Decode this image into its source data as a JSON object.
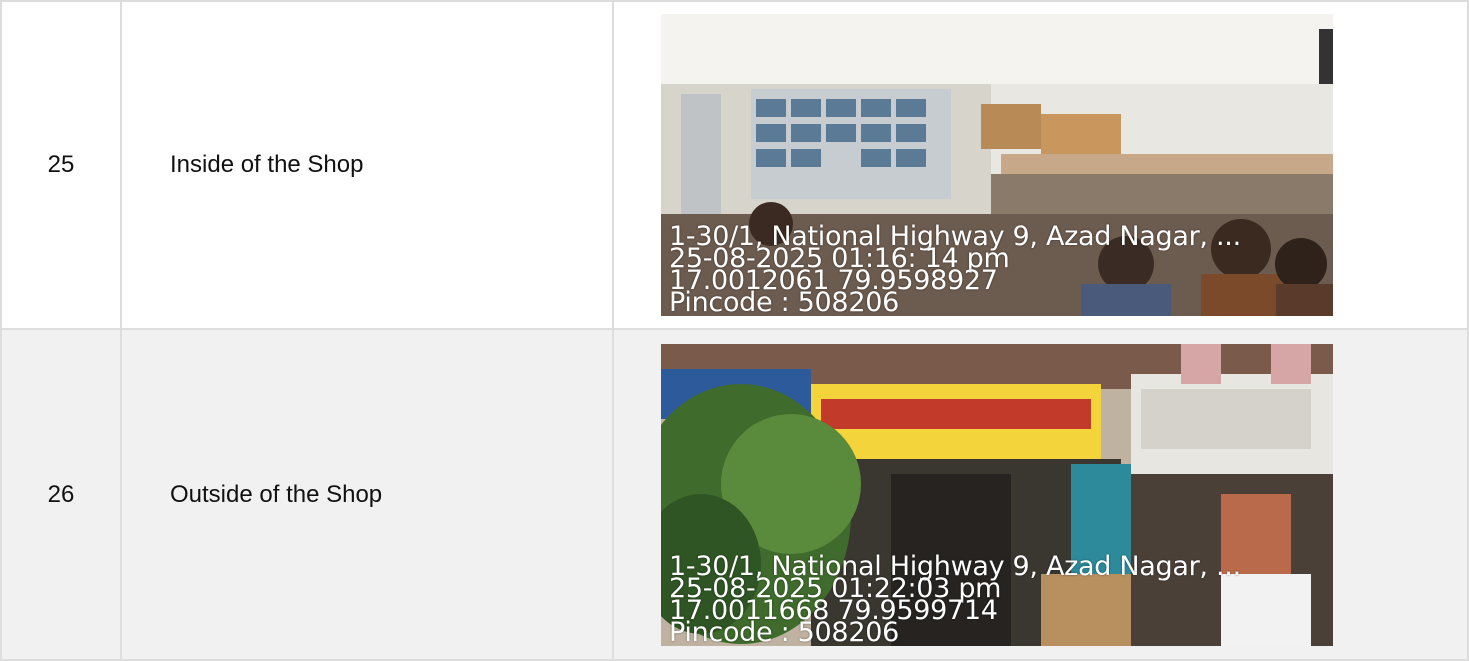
{
  "rows": [
    {
      "number": "25",
      "description": "Inside of the Shop",
      "photo": {
        "icon": "shop-interior-photo",
        "stamp": {
          "address": "1-30/1, National Highway 9, Azad Nagar, ...",
          "datetime": "25-08-2025 01:16: 14 pm",
          "coords": "17.0012061 79.9598927",
          "pincode": "Pincode : 508206"
        }
      }
    },
    {
      "number": "26",
      "description": "Outside of the Shop",
      "photo": {
        "icon": "shop-exterior-photo",
        "stamp": {
          "address": "1-30/1, National Highway 9, Azad Nagar, ...",
          "datetime": "25-08-2025 01:22:03 pm",
          "coords": "17.0011668 79.9599714",
          "pincode": "Pincode : 508206"
        }
      }
    }
  ],
  "colors": {
    "border": "#dddddd",
    "row_alt_bg": "#f1f1f1",
    "stamp_text": "#ffffff"
  }
}
